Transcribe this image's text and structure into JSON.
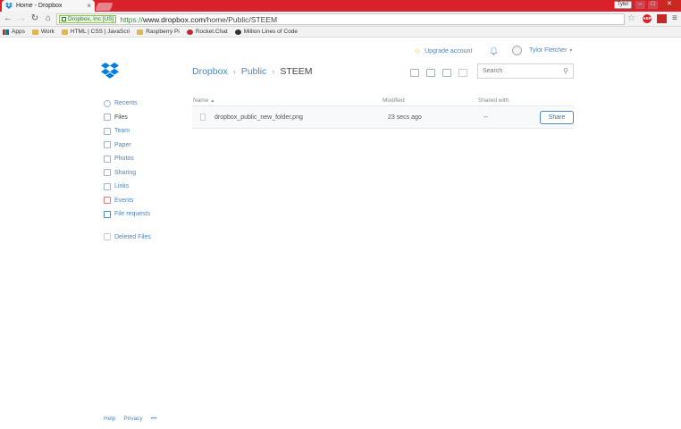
{
  "browser": {
    "tab_title": "Home - Dropbox",
    "tab_close": "×",
    "profile_name": "Tyler",
    "ev_cert": "Dropbox, Inc [US]",
    "url_proto": "https://",
    "url_host": "www.dropbox.com",
    "url_path": "/home/Public/STEEM",
    "abp_label": "ABP",
    "bookmarks": [
      {
        "label": "Apps",
        "icon": "apps-icon"
      },
      {
        "label": "Work",
        "icon": "folder-icon"
      },
      {
        "label": "HTML | CSS | JavaScri",
        "icon": "folder-icon"
      },
      {
        "label": "Raspberry Pi",
        "icon": "folder-icon"
      },
      {
        "label": "Rocket.Chat",
        "icon": "rocket-icon"
      },
      {
        "label": "Million Lines of Code",
        "icon": "site-icon"
      }
    ]
  },
  "header": {
    "upgrade_label": "Upgrade account",
    "user_name": "Tylor Fletcher"
  },
  "breadcrumb": {
    "root": "Dropbox",
    "parent": "Public",
    "current": "STEEM",
    "sep": "›"
  },
  "search": {
    "placeholder": "Search"
  },
  "sidebar": {
    "items": [
      {
        "label": "Recents",
        "icon": "clock-icon"
      },
      {
        "label": "Files",
        "icon": "files-icon"
      },
      {
        "label": "Team",
        "icon": "team-icon"
      },
      {
        "label": "Paper",
        "icon": "paper-icon"
      },
      {
        "label": "Photos",
        "icon": "photos-icon"
      },
      {
        "label": "Sharing",
        "icon": "sharing-icon"
      },
      {
        "label": "Links",
        "icon": "link-icon"
      },
      {
        "label": "Events",
        "icon": "calendar-icon"
      },
      {
        "label": "File requests",
        "icon": "file-request-icon"
      },
      {
        "label": "Deleted Files",
        "icon": "trash-icon"
      }
    ]
  },
  "table": {
    "headers": {
      "name": "Name",
      "modified": "Modified",
      "shared": "Shared with"
    },
    "rows": [
      {
        "name": "dropbox_public_new_folder.png",
        "modified": "23 secs ago",
        "shared": "--",
        "action": "Share"
      }
    ]
  },
  "footer": {
    "help": "Help",
    "privacy": "Privacy",
    "more": "•••"
  },
  "colors": {
    "chrome_red": "#d8212b",
    "dropbox_blue": "#007ee5",
    "link_blue": "#4a86c5"
  }
}
